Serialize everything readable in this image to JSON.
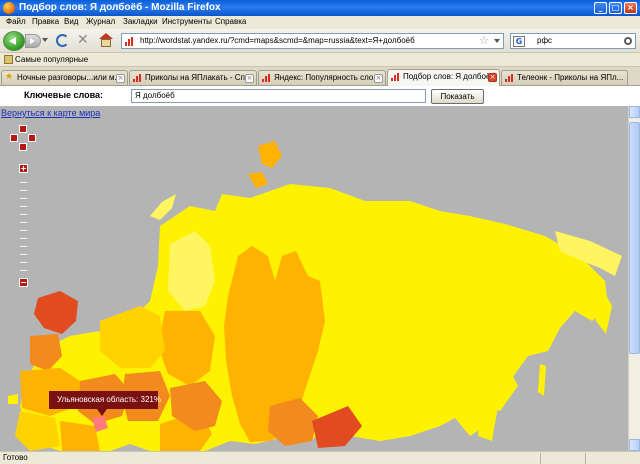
{
  "window": {
    "title": "Подбор слов: Я долбоёб - Mozilla Firefox",
    "buttons": {
      "minimize": "_",
      "maximize": "□",
      "close": "×"
    }
  },
  "menu": [
    "Файл",
    "Правка",
    "Вид",
    "Журнал",
    "Закладки",
    "Инструменты",
    "Справка"
  ],
  "nav": {
    "url": "http://wordstat.yandex.ru/?cmd=maps&scmd=&map=russia&text=Я+долбоёб",
    "search_value": "рфс",
    "search_engine": "G"
  },
  "bookmarks": {
    "label": "Самые популярные"
  },
  "tabs": [
    {
      "label": "Ночные разговоры...или м...",
      "icon": "star-icon",
      "active": false
    },
    {
      "label": "Приколы на ЯПлакать - Сп...",
      "icon": "yandex-stats-icon",
      "active": false
    },
    {
      "label": "Яндекс: Популярность сло...",
      "icon": "yandex-stats-icon",
      "active": false
    },
    {
      "label": "Подбор слов: Я долбоёб",
      "icon": "yandex-stats-icon",
      "active": true
    },
    {
      "label": "Телеонк - Приколы на ЯПл...",
      "icon": "yandex-stats-icon",
      "active": false
    }
  ],
  "form": {
    "label": "Ключевые слова:",
    "value": "Я долбоёб",
    "submit": "Показать"
  },
  "map": {
    "back_link": "Вернуться к карте мира",
    "tooltip": "Ульяновская область: 321%",
    "colors": {
      "background": "#b4b4b4",
      "yellow": "#fff200",
      "light_yellow": "#fff560",
      "orange": "#ffb300",
      "dark_orange": "#f28a1e",
      "red": "#e24a1f"
    }
  },
  "status": {
    "text": "Готово"
  }
}
